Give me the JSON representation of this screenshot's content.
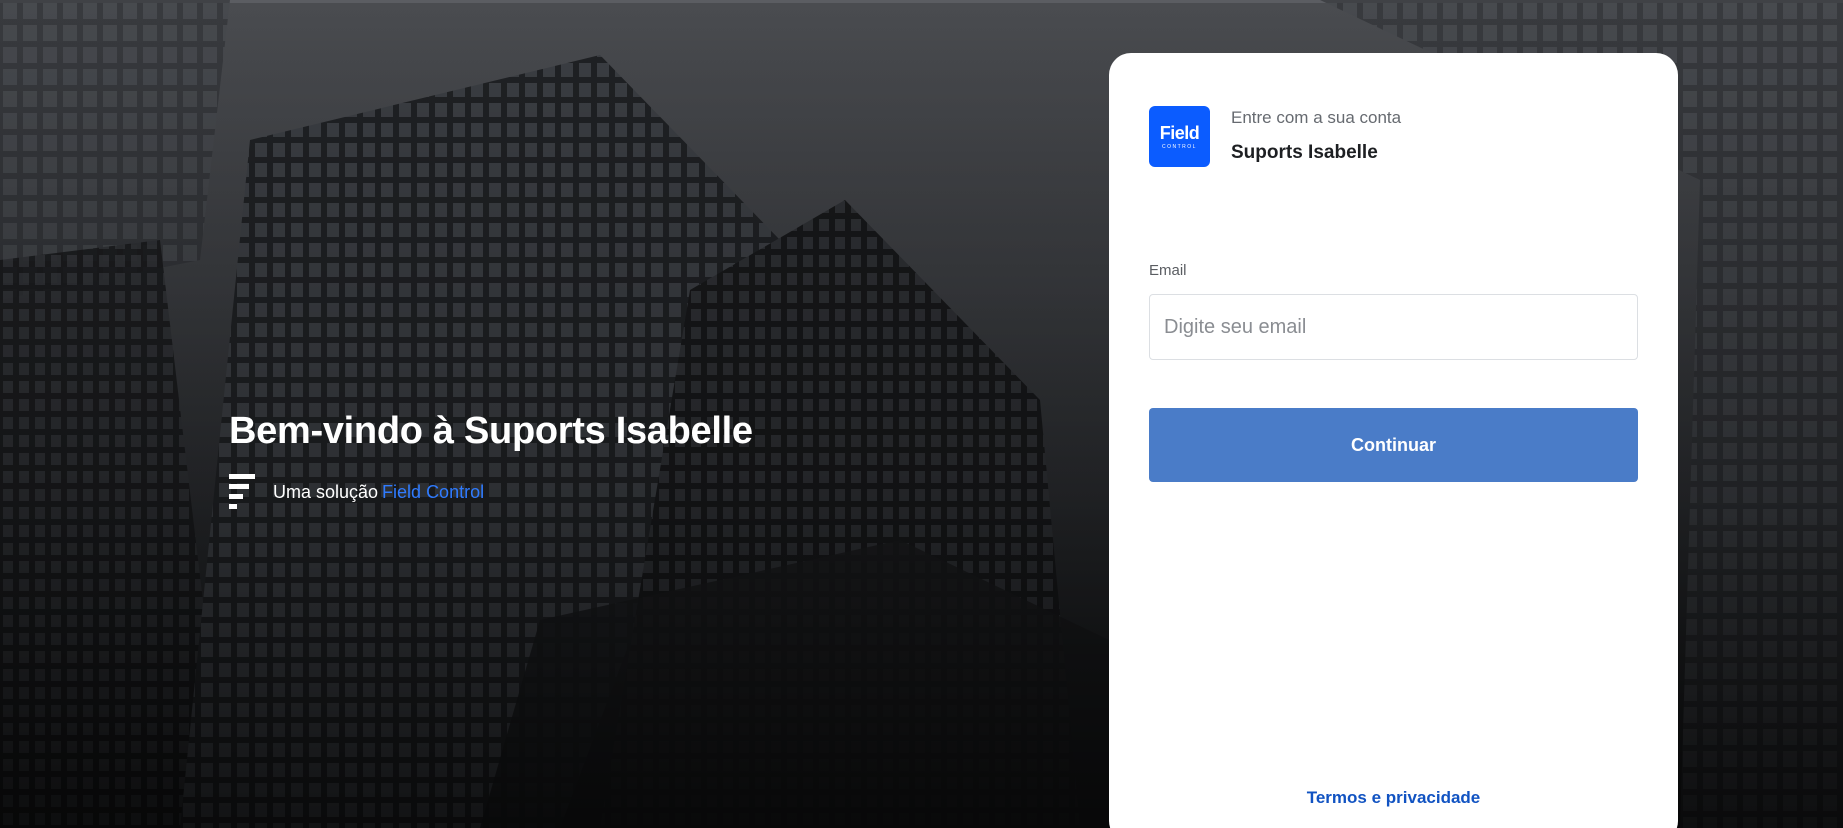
{
  "welcome": {
    "title": "Bem-vindo à Suports Isabelle",
    "solution_prefix": "Uma solução",
    "solution_link": "Field Control"
  },
  "login": {
    "logo_text": "Field",
    "logo_subtext": "CONTROL",
    "subtitle": "Entre com a sua conta",
    "account_name": "Suports Isabelle",
    "email_label": "Email",
    "email_placeholder": "Digite seu email",
    "email_value": "",
    "continue_label": "Continuar",
    "terms_link": "Termos e privacidade"
  },
  "colors": {
    "brand_blue": "#0b5cff",
    "button_blue": "#4a7cc8",
    "link_blue": "#1153c2",
    "solution_link_blue": "#2f7bff"
  },
  "icons": {
    "field_control_mark": "field-control-logo-icon",
    "brand_logo": "field-control-brand-logo"
  }
}
